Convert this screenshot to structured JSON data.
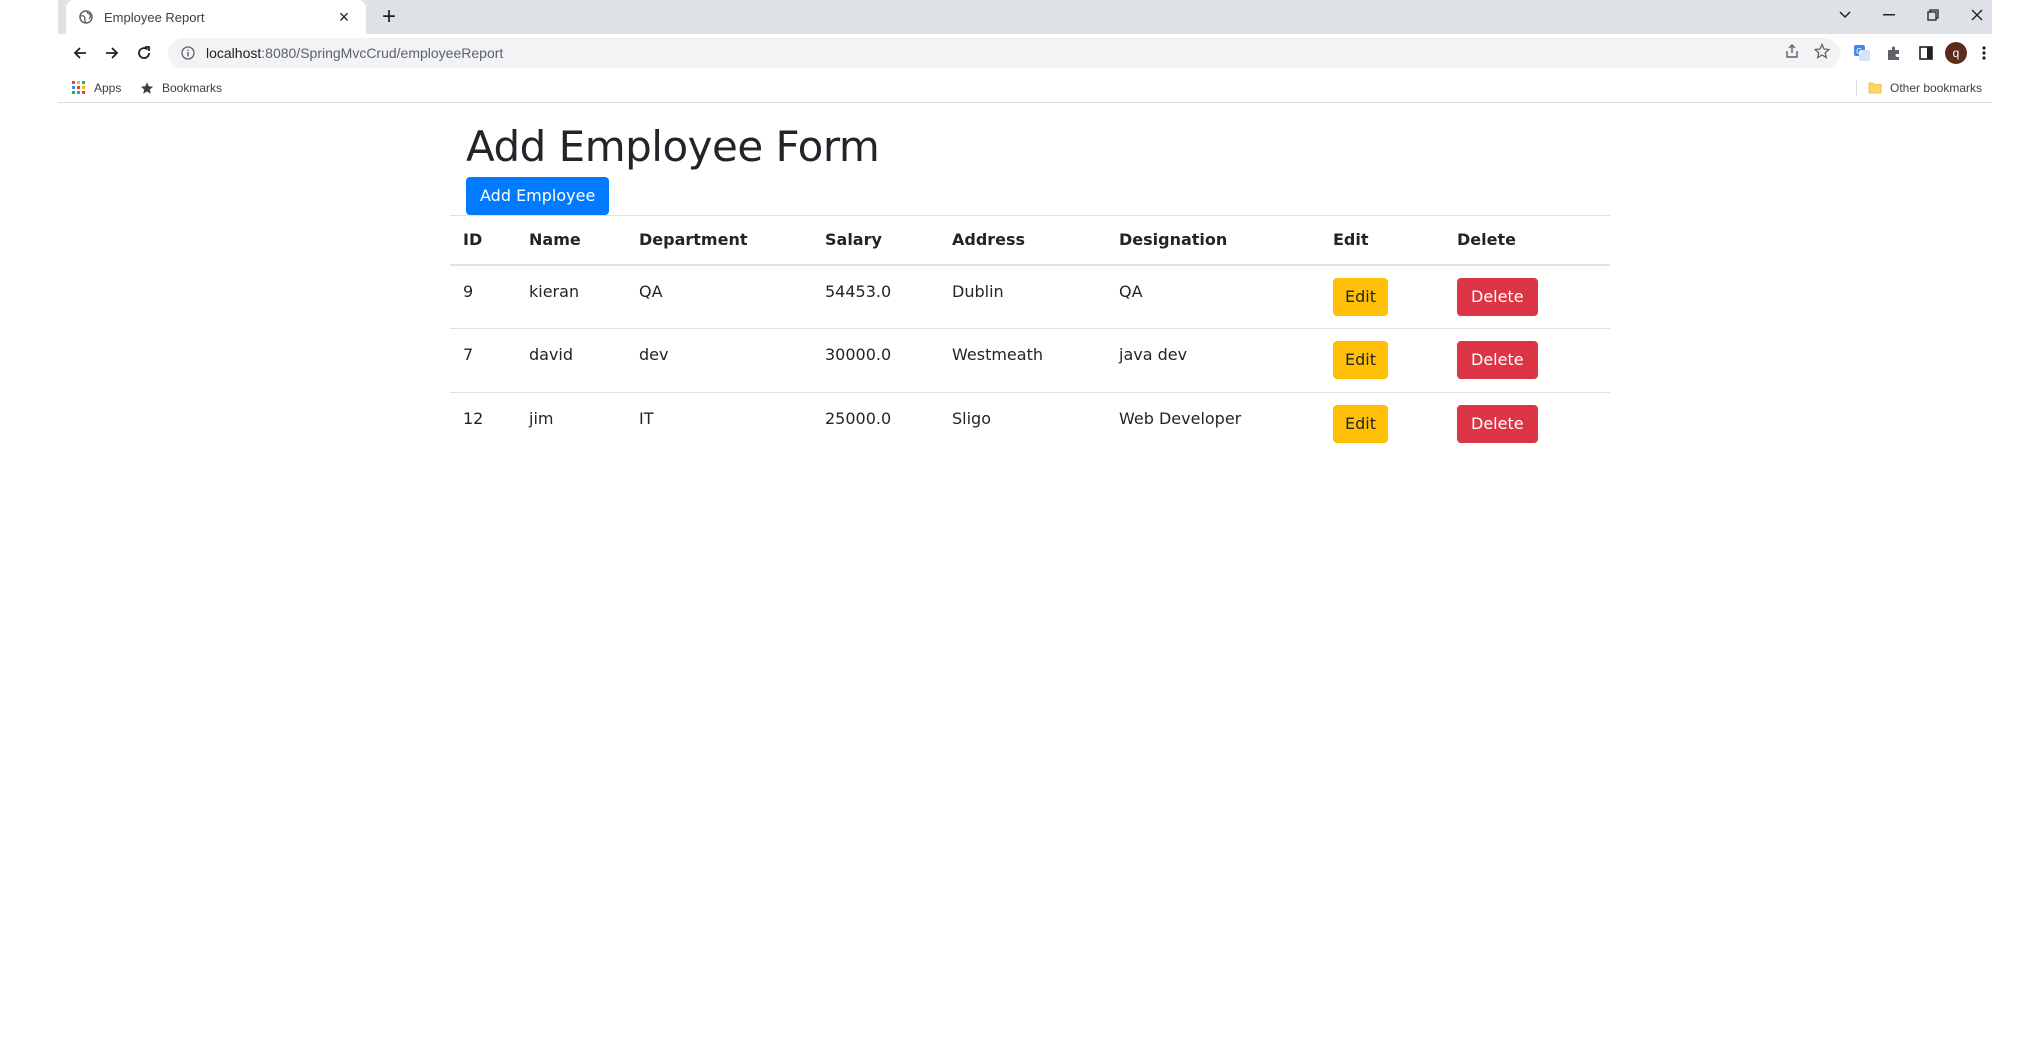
{
  "browser": {
    "tab_title": "Employee Report",
    "url_host": "localhost",
    "url_path": ":8080/SpringMvcCrud/employeeReport",
    "profile_initial": "q",
    "bookmarks": {
      "apps_label": "Apps",
      "bookmarks_label": "Bookmarks",
      "other_label": "Other bookmarks"
    }
  },
  "page": {
    "heading": "Add Employee Form",
    "add_button_label": "Add Employee",
    "table": {
      "columns": [
        "ID",
        "Name",
        "Department",
        "Salary",
        "Address",
        "Designation",
        "Edit",
        "Delete"
      ],
      "rows": [
        {
          "id": "9",
          "name": "kieran",
          "department": "QA",
          "salary": "54453.0",
          "address": "Dublin",
          "designation": "QA",
          "edit": "Edit",
          "delete": "Delete"
        },
        {
          "id": "7",
          "name": "david",
          "department": "dev",
          "salary": "30000.0",
          "address": "Westmeath",
          "designation": "java dev",
          "edit": "Edit",
          "delete": "Delete"
        },
        {
          "id": "12",
          "name": "jim",
          "department": "IT",
          "salary": "25000.0",
          "address": "Sligo",
          "designation": "Web Developer",
          "edit": "Edit",
          "delete": "Delete"
        }
      ]
    }
  },
  "colors": {
    "primary": "#007bff",
    "warning": "#ffc107",
    "danger": "#dc3545"
  }
}
